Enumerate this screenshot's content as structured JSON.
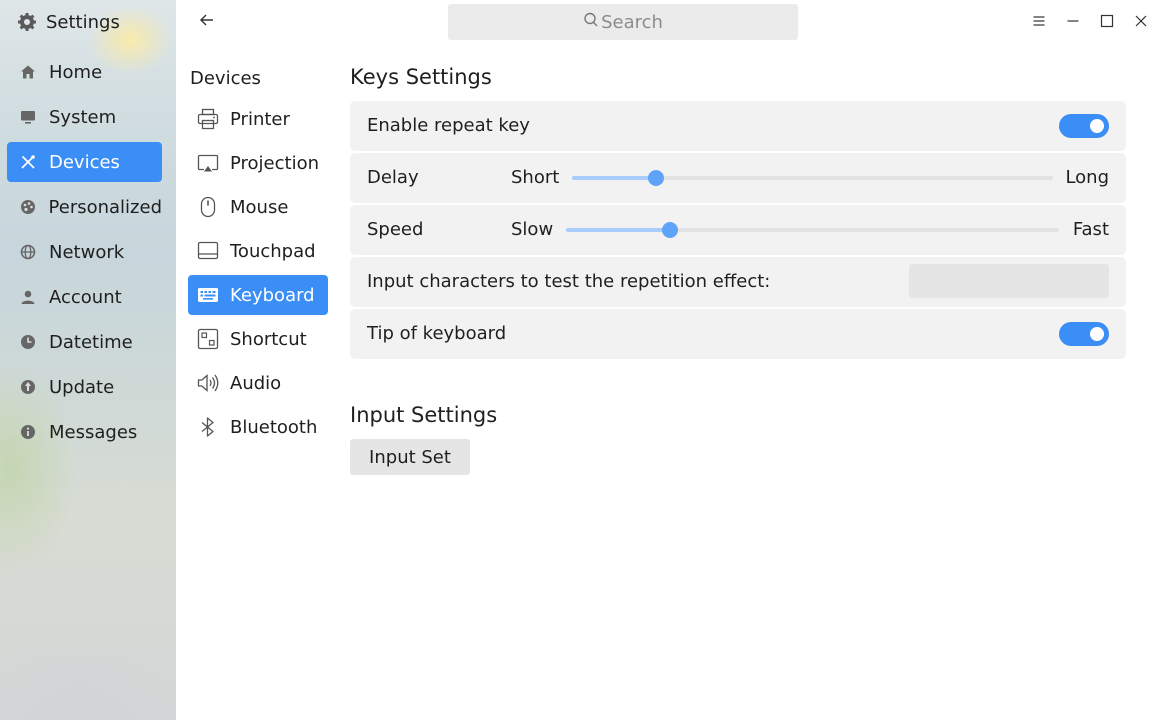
{
  "app": {
    "title": "Settings",
    "icon": "gear-icon"
  },
  "sidebar": {
    "items": [
      {
        "label": "Home",
        "icon": "home-icon"
      },
      {
        "label": "System",
        "icon": "monitor-icon"
      },
      {
        "label": "Devices",
        "icon": "tools-icon",
        "active": true
      },
      {
        "label": "Personalized",
        "icon": "palette-icon"
      },
      {
        "label": "Network",
        "icon": "globe-icon"
      },
      {
        "label": "Account",
        "icon": "user-icon"
      },
      {
        "label": "Datetime",
        "icon": "clock-icon"
      },
      {
        "label": "Update",
        "icon": "update-icon"
      },
      {
        "label": "Messages",
        "icon": "info-icon"
      }
    ]
  },
  "titlebar": {
    "search_placeholder": "Search",
    "controls": [
      "menu-icon",
      "minimize-icon",
      "maximize-icon",
      "close-icon"
    ]
  },
  "devices": {
    "title": "Devices",
    "items": [
      {
        "label": "Printer",
        "icon": "printer-icon"
      },
      {
        "label": "Projection",
        "icon": "projection-icon"
      },
      {
        "label": "Mouse",
        "icon": "mouse-icon"
      },
      {
        "label": "Touchpad",
        "icon": "touchpad-icon"
      },
      {
        "label": "Keyboard",
        "icon": "keyboard-icon",
        "active": true
      },
      {
        "label": "Shortcut",
        "icon": "shortcut-icon"
      },
      {
        "label": "Audio",
        "icon": "speaker-icon"
      },
      {
        "label": "Bluetooth",
        "icon": "bluetooth-icon"
      }
    ]
  },
  "keys_settings": {
    "title": "Keys Settings",
    "repeat_key": {
      "label": "Enable repeat key",
      "enabled": true
    },
    "delay": {
      "label": "Delay",
      "min_label": "Short",
      "max_label": "Long",
      "value": 0.175
    },
    "speed": {
      "label": "Speed",
      "min_label": "Slow",
      "max_label": "Fast",
      "value": 0.21
    },
    "test": {
      "label": "Input characters to test the repetition effect:",
      "value": ""
    },
    "tip": {
      "label": "Tip of keyboard",
      "enabled": true
    }
  },
  "input_settings": {
    "title": "Input Settings",
    "button_label": "Input Set"
  },
  "colors": {
    "accent": "#3a8ef6",
    "slider_fill": "#a9cdfb",
    "slider_handle": "#5fa3f8",
    "row_bg": "#f2f2f2"
  }
}
